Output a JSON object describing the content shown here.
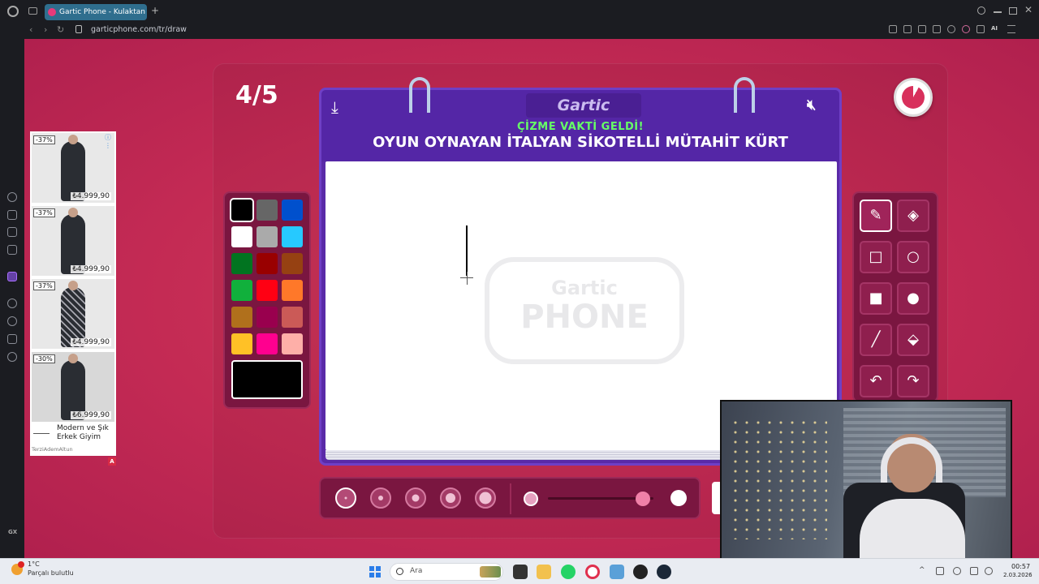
{
  "browser": {
    "tab_title": "Gartic Phone - Kulaktan Ku",
    "url": "garticphone.com/tr/draw",
    "new_tab_label": "+"
  },
  "game": {
    "round": "4/5",
    "logo": "Gartic",
    "subtitle": "ÇİZME VAKTİ GELDİ!",
    "phrase": "OYUN OYNAYAN İTALYAN SİKOTELLİ MÜTAHİT KÜRT",
    "watermark_top": "Gartic",
    "watermark_bottom": "PHONE",
    "download_icon": "⤓",
    "sound_icon": "🔇︎",
    "selected_color": "#000000",
    "timer_progress": 0.92
  },
  "palette": {
    "colors": [
      "#000000",
      "#666666",
      "#0050cd",
      "#ffffff",
      "#aaaaaa",
      "#26c9ff",
      "#017420",
      "#990000",
      "#964112",
      "#11b03c",
      "#ff0013",
      "#ff7829",
      "#b0701c",
      "#99004e",
      "#cb5a57",
      "#ffc126",
      "#ff008f",
      "#feafa8"
    ]
  },
  "tools": [
    {
      "name": "pencil",
      "glyph": "✎"
    },
    {
      "name": "eraser",
      "glyph": "◈"
    },
    {
      "name": "rectangle-outline",
      "glyph": "□"
    },
    {
      "name": "ellipse-outline",
      "glyph": "○"
    },
    {
      "name": "rectangle-filled",
      "glyph": "■"
    },
    {
      "name": "ellipse-filled",
      "glyph": "●"
    },
    {
      "name": "line",
      "glyph": "╱"
    },
    {
      "name": "fill-bucket",
      "glyph": "⬙"
    },
    {
      "name": "undo",
      "glyph": "↶"
    },
    {
      "name": "redo",
      "glyph": "↷"
    }
  ],
  "brush": {
    "sizes": 5,
    "selected_index": 0,
    "opacity_fraction": 0.9
  },
  "ad": {
    "items": [
      {
        "badge": "-37%",
        "price": "₺4.999,90"
      },
      {
        "badge": "-37%",
        "price": "₺4.999,90"
      },
      {
        "badge": "-37%",
        "price": "₺4.999,90"
      },
      {
        "badge": "-30%",
        "price": "₺6.999,90"
      }
    ],
    "title": "Modern ve Şık Erkek Giyim",
    "brand": "TerziAdemAltun",
    "badge_a": "A",
    "info": "ⓘ ⋮"
  },
  "sidebar": {
    "gx_label": "GX"
  },
  "taskbar": {
    "weather_temp": "1°C",
    "weather_text": "Parçalı bulutlu",
    "search_placeholder": "Ara",
    "time": "00:57",
    "date": "2.03.2026"
  }
}
